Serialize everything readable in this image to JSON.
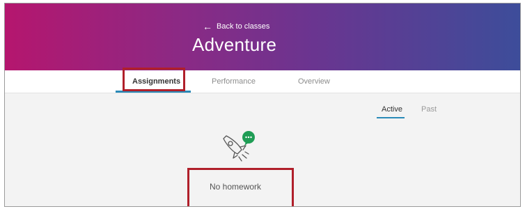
{
  "header": {
    "back_label": "Back to classes",
    "class_title": "Adventure"
  },
  "tabs": [
    {
      "label": "Assignments",
      "selected": true
    },
    {
      "label": "Performance",
      "selected": false
    },
    {
      "label": "Overview",
      "selected": false
    }
  ],
  "filters": [
    {
      "label": "Active",
      "selected": true
    },
    {
      "label": "Past",
      "selected": false
    }
  ],
  "empty_state": {
    "icon": "rocket-icon",
    "badge_icon": "chat-bubble-icon",
    "message": "No homework"
  },
  "colors": {
    "header_gradient_start": "#b5166e",
    "header_gradient_end": "#3d4d9a",
    "accent": "#2a8ab8",
    "badge": "#1f9d55",
    "highlight_box": "#b01f2a"
  }
}
